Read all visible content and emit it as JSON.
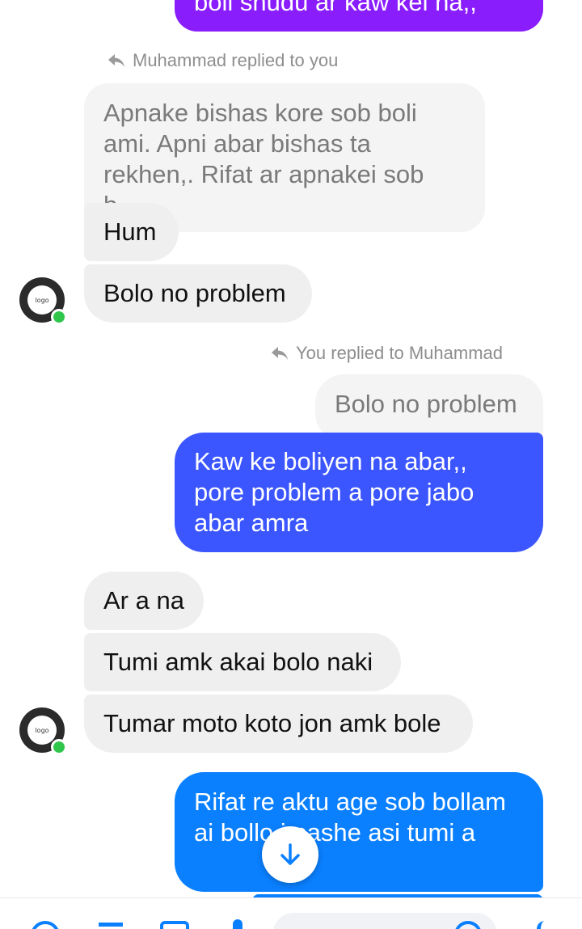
{
  "thread": {
    "top_partial_message": "boli shudu ar kaw kei na,,",
    "reply_note_1": "Muhammad replied to you",
    "quoted_1": "Apnake bishas kore sob boli ami.  Apni abar bishas ta rekhen,. Rifat ar apnakei sob b...",
    "incoming_1": "Hum",
    "incoming_2": "Bolo no problem",
    "reply_note_2": "You replied to Muhammad",
    "quoted_2": "Bolo no problem",
    "outgoing_1": "Kaw ke boliyen na abar,, pore problem a pore jabo abar amra",
    "incoming_3": "Ar a na",
    "incoming_4": "Tumi amk akai bolo naki",
    "incoming_5": "Tumar moto koto jon amk bole",
    "outgoing_2": "Rifat re aktu age sob bollam ai bollo j pashe asi tumi a"
  },
  "avatar": {
    "label": "logo"
  },
  "icons": {
    "reply": "reply-arrow-icon",
    "scroll_down": "arrow-down-icon",
    "online": "online-dot-icon"
  },
  "colors": {
    "accent": "#0a80ff",
    "purple": "#8a1dfc",
    "indigo": "#3b55ff",
    "incoming": "#efefef",
    "online": "#2fc64b"
  }
}
